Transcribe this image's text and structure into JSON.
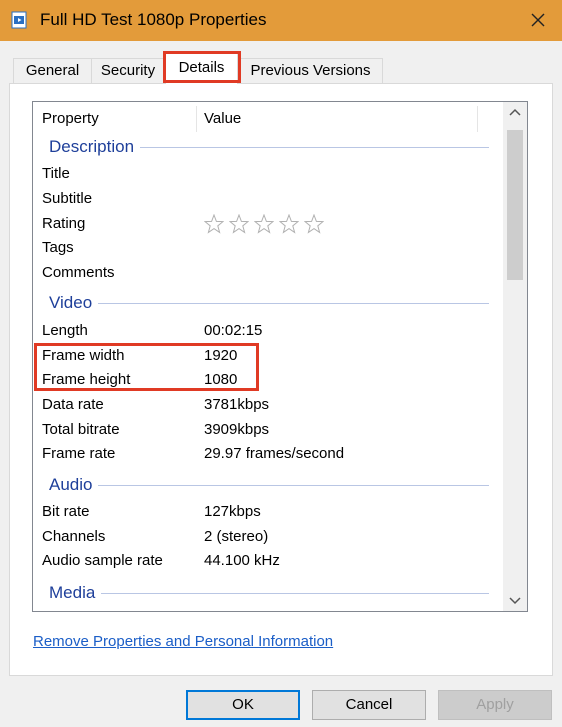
{
  "window": {
    "title": "Full HD Test 1080p Properties",
    "title_bar_color": "#e39b3a"
  },
  "tabs": [
    {
      "label": "General",
      "selected": false
    },
    {
      "label": "Security",
      "selected": false
    },
    {
      "label": "Details",
      "selected": true
    },
    {
      "label": "Previous Versions",
      "selected": false
    }
  ],
  "list": {
    "header": {
      "property": "Property",
      "value": "Value"
    },
    "groups": {
      "description": {
        "label": "Description",
        "rows": {
          "title": {
            "name": "Title",
            "value": ""
          },
          "subtitle": {
            "name": "Subtitle",
            "value": ""
          },
          "rating": {
            "name": "Rating",
            "stars_filled": 0,
            "stars_total": 5
          },
          "tags": {
            "name": "Tags",
            "value": ""
          },
          "comments": {
            "name": "Comments",
            "value": ""
          }
        }
      },
      "video": {
        "label": "Video",
        "rows": {
          "length": {
            "name": "Length",
            "value": "00:02:15"
          },
          "frame_width": {
            "name": "Frame width",
            "value": "1920"
          },
          "frame_height": {
            "name": "Frame height",
            "value": "1080"
          },
          "data_rate": {
            "name": "Data rate",
            "value": "3781kbps"
          },
          "total_bitrate": {
            "name": "Total bitrate",
            "value": "3909kbps"
          },
          "frame_rate": {
            "name": "Frame rate",
            "value": "29.97 frames/second"
          }
        }
      },
      "audio": {
        "label": "Audio",
        "rows": {
          "bit_rate": {
            "name": "Bit rate",
            "value": "127kbps"
          },
          "channels": {
            "name": "Channels",
            "value": "2 (stereo)"
          },
          "sample_rate": {
            "name": "Audio sample rate",
            "value": "44.100 kHz"
          }
        }
      },
      "media": {
        "label": "Media"
      }
    }
  },
  "links": {
    "remove_properties": "Remove Properties and Personal Information"
  },
  "buttons": {
    "ok": "OK",
    "cancel": "Cancel",
    "apply": "Apply",
    "apply_enabled": false
  },
  "colors": {
    "highlight": "#e03a24",
    "group_label": "#1e3f9a",
    "link": "#1b5ec7"
  }
}
